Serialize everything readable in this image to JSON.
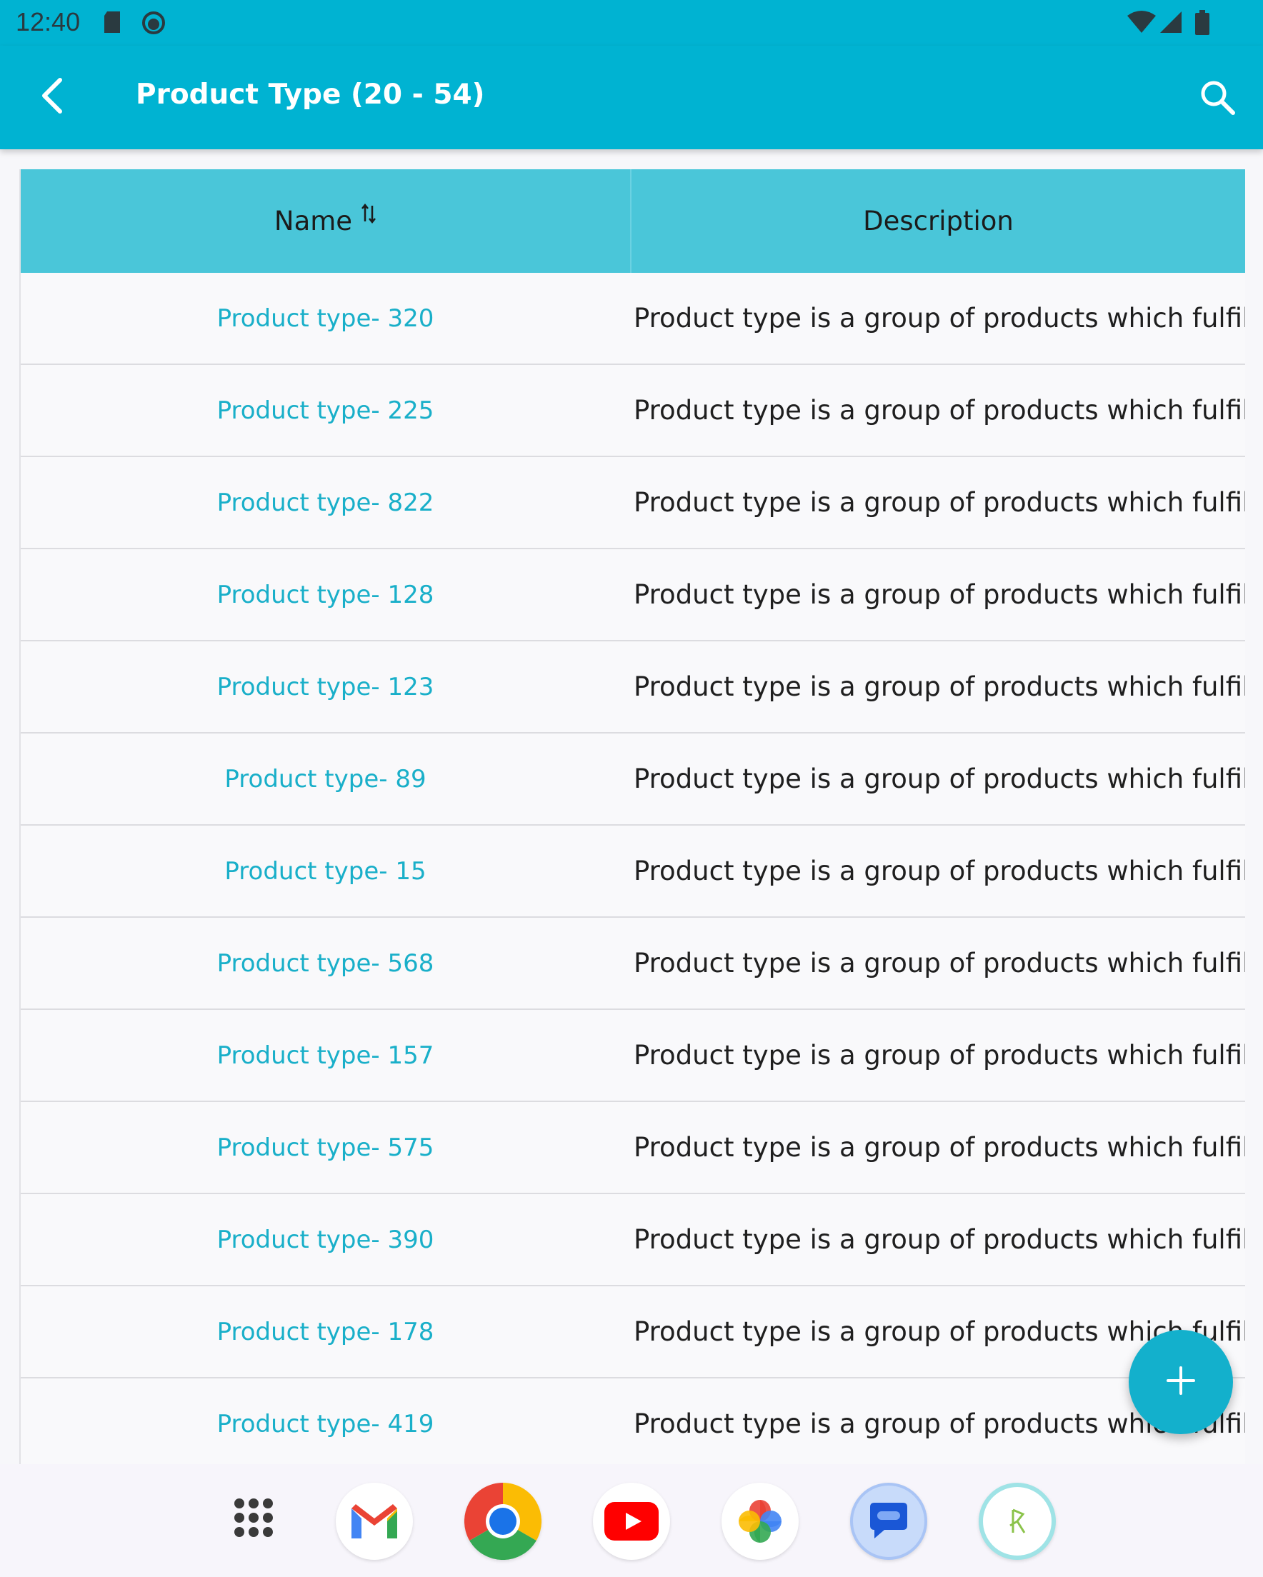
{
  "status_bar": {
    "time": "12:40",
    "left_icons": [
      "sd-card-icon",
      "face-icon"
    ],
    "right_icons": [
      "wifi-icon",
      "signal-icon",
      "battery-icon"
    ]
  },
  "app_bar": {
    "title": "Product Type (20 - 54)",
    "background_color": "#00b3d2",
    "icons": [
      "back-arrow-icon",
      "search-icon"
    ]
  },
  "table": {
    "header": {
      "name": "Name",
      "description": "Description",
      "name_sort_icon": "sort-icon"
    },
    "rows": [
      {
        "name": "Product type- 320",
        "description": "Product type is a group of products which fulfill ..."
      },
      {
        "name": "Product type- 225",
        "description": "Product type is a group of products which fulfill ..."
      },
      {
        "name": "Product type- 822",
        "description": "Product type is a group of products which fulfill ..."
      },
      {
        "name": "Product type- 128",
        "description": "Product type is a group of products which fulfill ..."
      },
      {
        "name": "Product type- 123",
        "description": "Product type is a group of products which fulfill ..."
      },
      {
        "name": "Product type- 89",
        "description": "Product type is a group of products which fulfill ..."
      },
      {
        "name": "Product type- 15",
        "description": "Product type is a group of products which fulfill ..."
      },
      {
        "name": "Product type- 568",
        "description": "Product type is a group of products which fulfill ..."
      },
      {
        "name": "Product type- 157",
        "description": "Product type is a group of products which fulfill ..."
      },
      {
        "name": "Product type- 575",
        "description": "Product type is a group of products which fulfill ..."
      },
      {
        "name": "Product type- 390",
        "description": "Product type is a group of products which fulfill ..."
      },
      {
        "name": "Product type- 178",
        "description": "Product type is a group of products which fulfill ..."
      },
      {
        "name": "Product type- 419",
        "description": "Product type is a group of products which fulfill ..."
      }
    ],
    "header_color": "#4ac6d9",
    "link_color": "#19afc9"
  },
  "fab": {
    "icon": "plus-icon",
    "color": "#13b0cc"
  },
  "dock": {
    "apps": [
      "app-drawer-icon",
      "gmail-icon",
      "chrome-icon",
      "youtube-icon",
      "photos-icon",
      "messages-icon",
      "custom-app-icon"
    ]
  }
}
